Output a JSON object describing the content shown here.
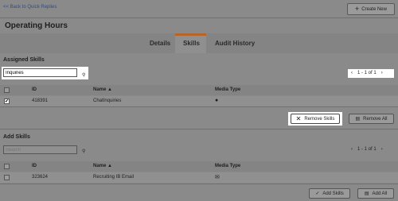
{
  "header": {
    "back_link": "<< Back to Quick Replies",
    "create_new": "Create New",
    "page_title": "Operating Hours"
  },
  "tabs": [
    {
      "label": "Details",
      "active": false
    },
    {
      "label": "Skills",
      "active": true
    },
    {
      "label": "Audit History",
      "active": false
    }
  ],
  "assigned": {
    "title": "Assigned Skills",
    "search_value": "Inquiries",
    "pager": "1 - 1 of 1",
    "columns": {
      "id": "ID",
      "name": "Name ▲",
      "media": "Media Type"
    },
    "rows": [
      {
        "checked": true,
        "id": "418391",
        "name": "ChatInquiries",
        "media_icon": "chat-icon"
      }
    ],
    "remove_skills": "Remove Skills",
    "remove_all": "Remove All"
  },
  "add": {
    "title": "Add Skills",
    "search_placeholder": "Search",
    "pager": "1 - 1 of 1",
    "columns": {
      "id": "ID",
      "name": "Name ▲",
      "media": "Media Type"
    },
    "rows": [
      {
        "checked": false,
        "id": "323624",
        "name": "Recruiting IB Email",
        "media_icon": "email-icon"
      }
    ],
    "add_skills": "Add Skills",
    "add_all": "Add All"
  }
}
